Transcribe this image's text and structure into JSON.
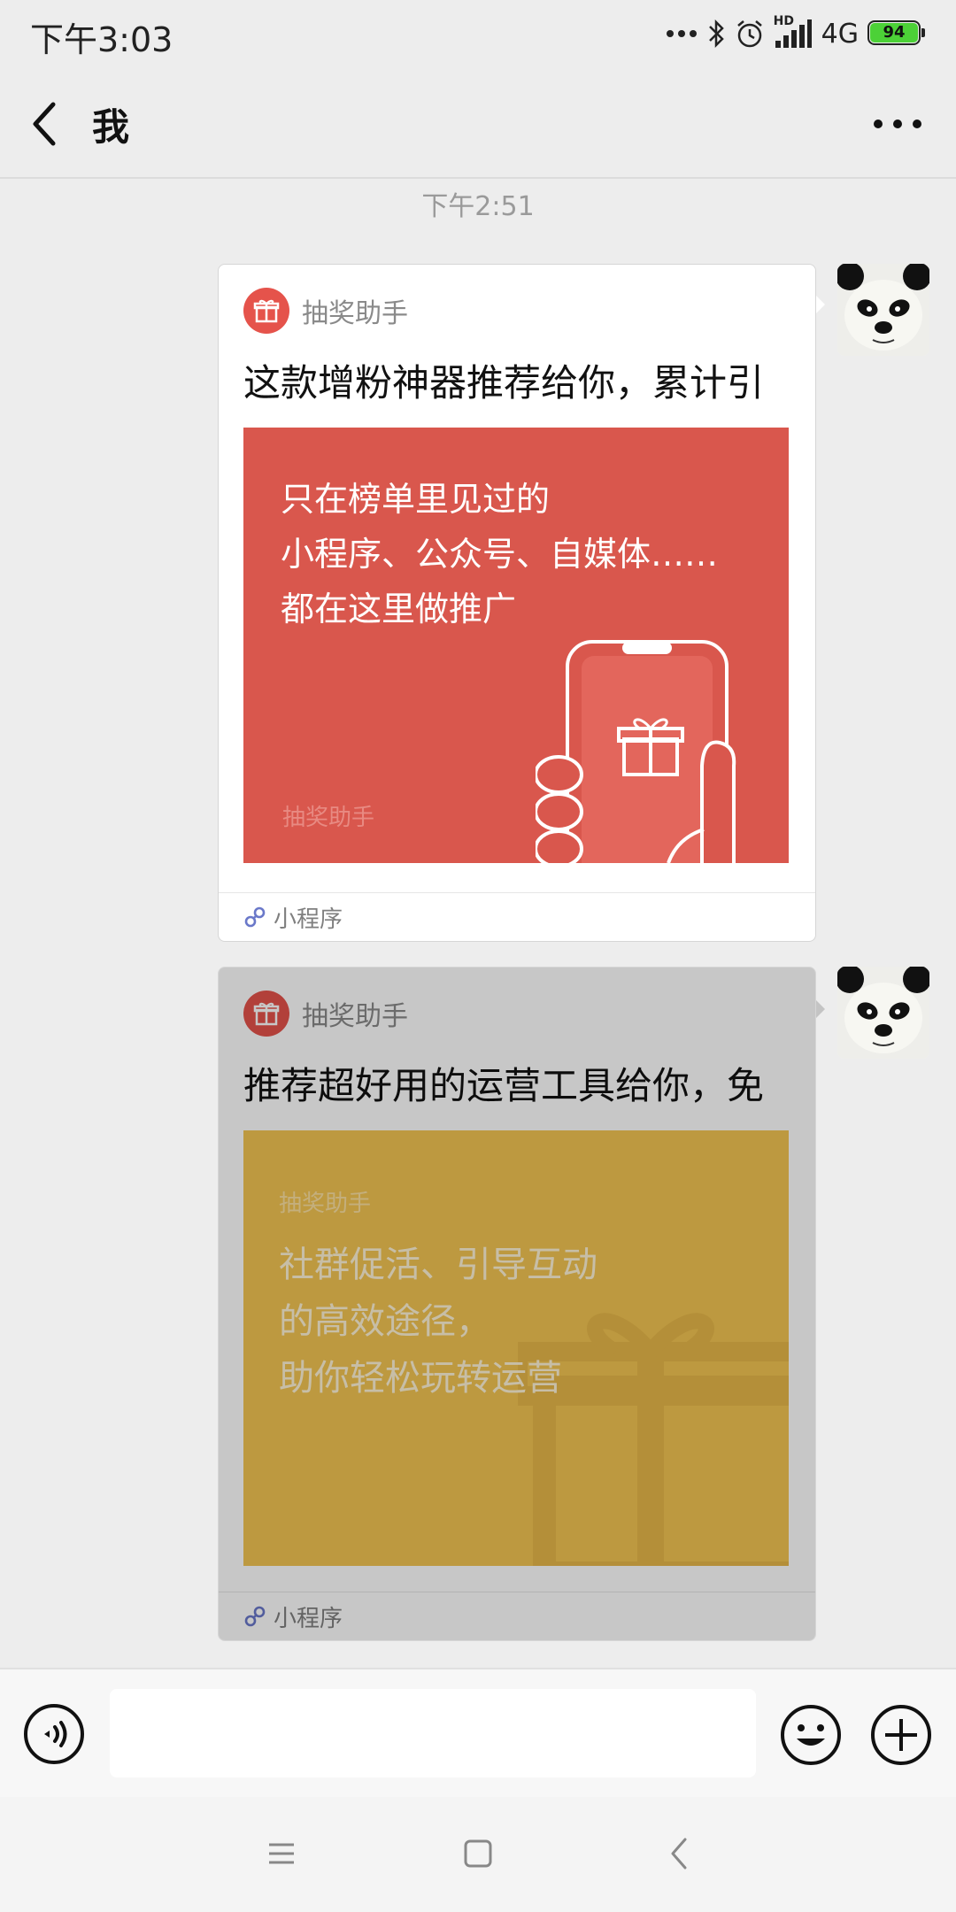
{
  "status_bar": {
    "time": "下午3:03",
    "network": "4G",
    "battery": "94",
    "hd_label": "HD"
  },
  "nav": {
    "title": "我"
  },
  "chat": {
    "timestamp": "下午2:51"
  },
  "messages": [
    {
      "app_name": "抽奖助手",
      "title": "这款增粉神器推荐给你，累计引",
      "banner_lines": [
        "只在榜单里见过的",
        "小程序、公众号、自媒体……",
        "都在这里做推广"
      ],
      "banner_brand": "抽奖助手",
      "banner_color": "#d9574d",
      "footer_label": "小程序"
    },
    {
      "app_name": "抽奖助手",
      "title": "推荐超好用的运营工具给你，免",
      "banner_brand": "抽奖助手",
      "banner_lines": [
        "社群促活、引导互动",
        "的高效途径，",
        "助你轻松玩转运营"
      ],
      "banner_color": "#c5a54e",
      "footer_label": "小程序"
    }
  ],
  "input": {
    "value": ""
  },
  "icons": {
    "back": "chevron-left-icon",
    "more": "more-icon",
    "gift": "gift-icon",
    "link": "mini-program-link-icon",
    "voice": "voice-icon",
    "emoji": "emoji-icon",
    "plus": "plus-icon"
  }
}
